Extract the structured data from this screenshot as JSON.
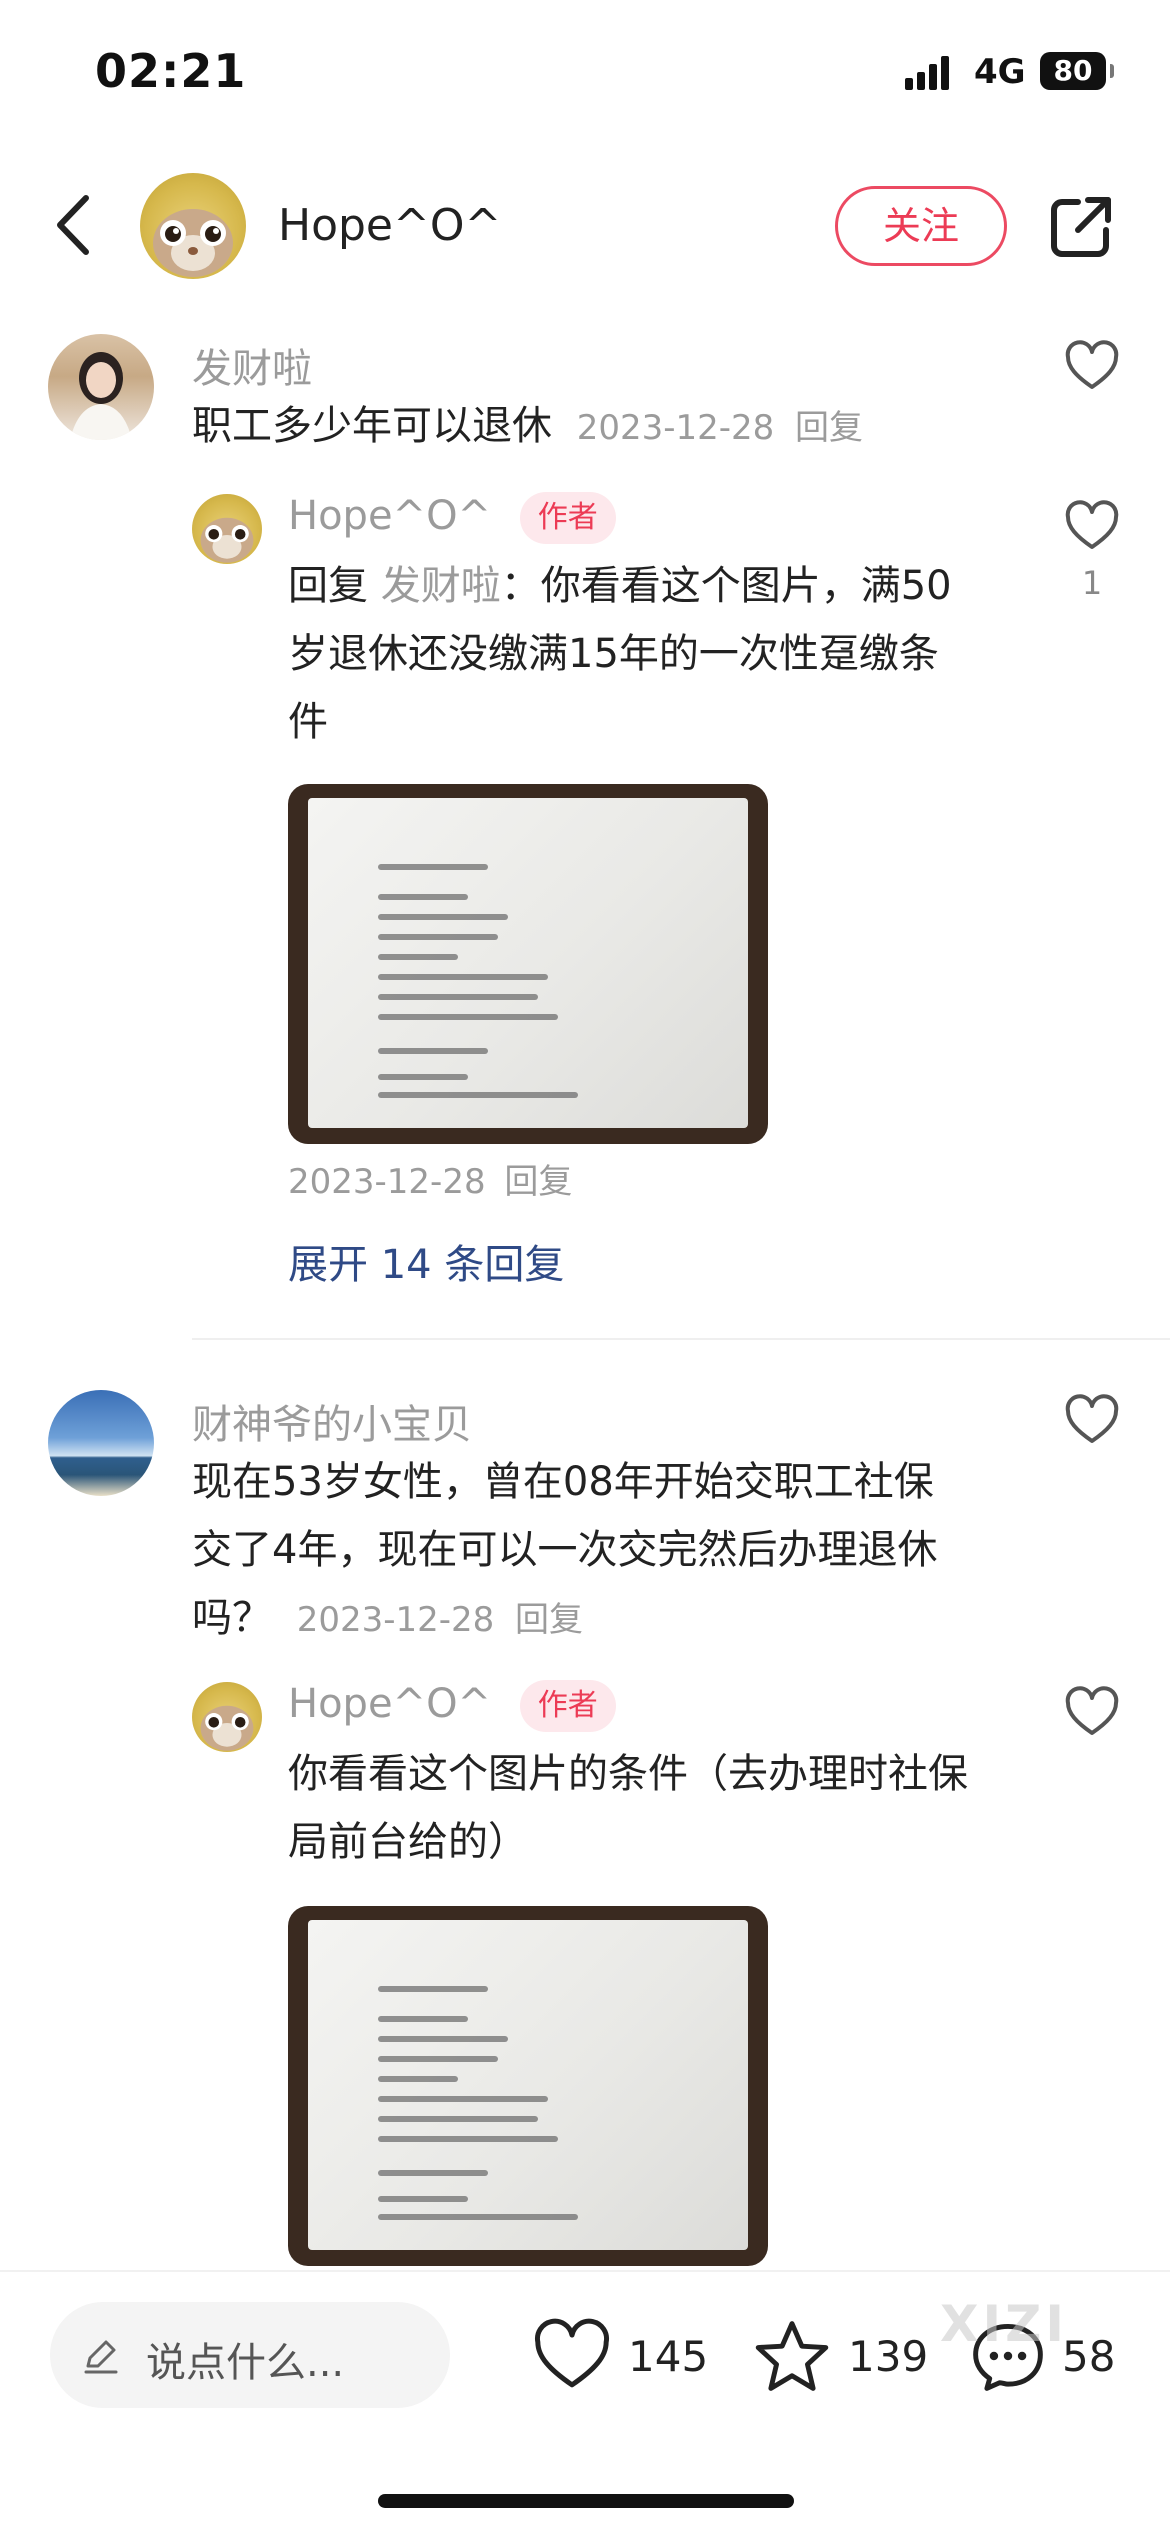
{
  "status_bar": {
    "time": "02:21",
    "network": "4G",
    "battery": "80"
  },
  "header": {
    "author": "Hope^O^",
    "follow_label": "关注"
  },
  "comments": [
    {
      "username": "发财啦",
      "text": "职工多少年可以退休",
      "date": "2023-12-28",
      "reply_label": "回复",
      "reply": {
        "username": "Hope^O^",
        "tag": "作者",
        "prefix": "回复",
        "mention": "发财啦",
        "lines": [
          "：你看看这个图片，满50",
          "岁退休还没缴满15年的一次性趸缴条",
          "件"
        ],
        "date": "2023-12-28",
        "reply_label": "回复",
        "likes": "1"
      },
      "expand_label": "展开 14 条回复"
    },
    {
      "username": "财神爷的小宝贝",
      "lines": [
        "现在53岁女性，曾在08年开始交职工社保",
        "交了4年，现在可以一次交完然后办理退休",
        "吗？"
      ],
      "date": "2023-12-28",
      "reply_label": "回复",
      "reply": {
        "username": "Hope^O^",
        "tag": "作者",
        "lines": [
          "你看看这个图片的条件（去办理时社保",
          "局前台给的）"
        ]
      }
    }
  ],
  "bottom_bar": {
    "input_placeholder": "说点什么...",
    "likes": "145",
    "stars": "139",
    "comments": "58",
    "watermark": "XIZI"
  }
}
